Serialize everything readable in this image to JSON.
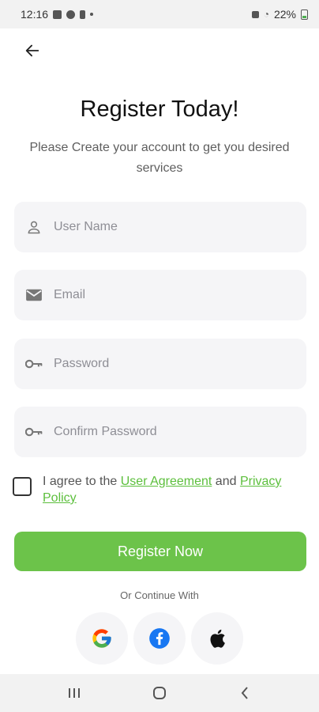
{
  "status_bar": {
    "time": "12:16",
    "battery": "22%"
  },
  "header": {
    "title": "Register Today!",
    "subtitle": "Please Create your account to get you desired services"
  },
  "form": {
    "username": {
      "placeholder": "User Name",
      "icon": "user-icon"
    },
    "email": {
      "placeholder": "Email",
      "icon": "mail-icon"
    },
    "password": {
      "placeholder": "Password",
      "icon": "key-icon"
    },
    "confirm_password": {
      "placeholder": "Confirm Password",
      "icon": "key-icon"
    }
  },
  "agreement": {
    "prefix": "I agree to the ",
    "user_agreement": "User Agreement",
    "middle": " and ",
    "privacy_policy": "Privacy Policy",
    "checked": false
  },
  "register_button": "Register Now",
  "continue_with": "Or Continue With",
  "social": [
    "google",
    "facebook",
    "apple"
  ],
  "colors": {
    "accent": "#6cc34a",
    "link": "#5cbf3c",
    "field_bg": "#f5f5f7"
  }
}
